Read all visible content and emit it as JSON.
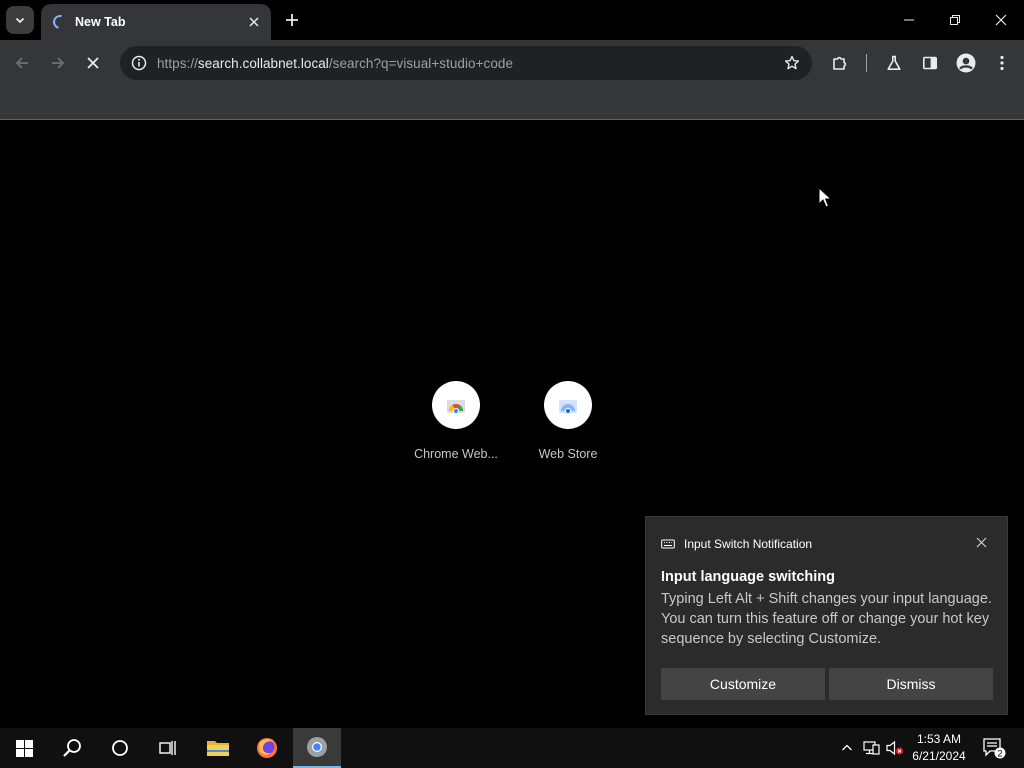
{
  "browser": {
    "tab": {
      "title": "New Tab"
    },
    "address": {
      "scheme": "https://",
      "host": "search.collabnet.local",
      "path": "/search?q=visual+studio+code"
    }
  },
  "shortcuts": [
    {
      "label": "Chrome Web..."
    },
    {
      "label": "Web Store"
    }
  ],
  "notification": {
    "app": "Input Switch Notification",
    "title": "Input language switching",
    "body": "Typing Left Alt + Shift changes your input language. You can turn this feature off or change your hot key sequence by selecting Customize.",
    "customize_label": "Customize",
    "dismiss_label": "Dismiss"
  },
  "taskbar": {
    "time": "1:53 AM",
    "date": "6/21/2024",
    "notification_count": "2"
  },
  "colors": {
    "accent": "#8ab4f8",
    "toolbar": "#35363a",
    "taskbar_active": "#76b9ed"
  }
}
